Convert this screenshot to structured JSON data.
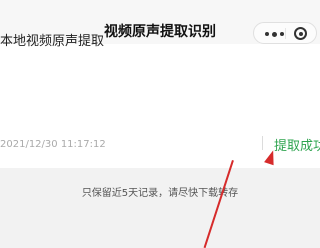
{
  "navbar": {
    "title": "视频原声提取识别",
    "menu_icon": "more-dots-icon",
    "close_icon": "miniprogram-close-icon"
  },
  "record": {
    "title": "本地视频原声提取",
    "date": "2021/12/30 11:17:12",
    "status": "提取成功"
  },
  "notice": "只保留近5天记录，请尽快下载转存",
  "colors": {
    "status_green": "#2ea44f",
    "annotation_red": "#d62b2b"
  }
}
